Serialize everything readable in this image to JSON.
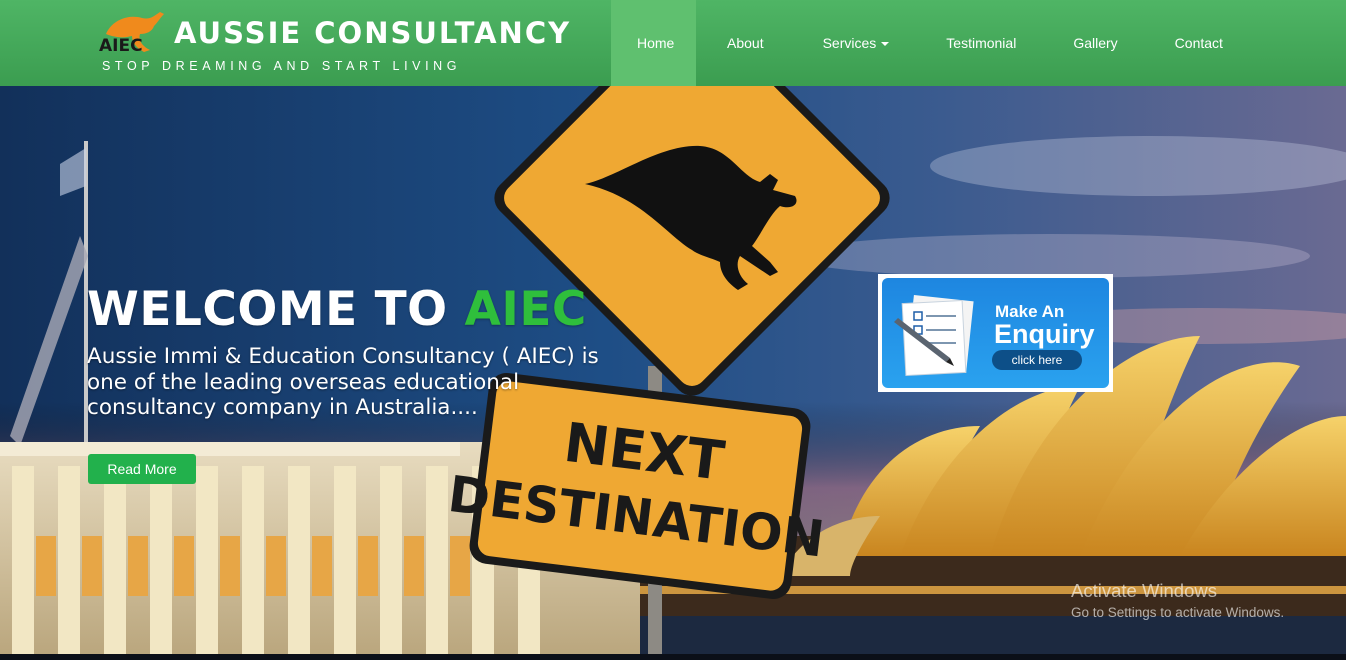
{
  "brand": {
    "logo_text": "AIEC",
    "title": "AUSSIE CONSULTANCY",
    "tagline": "STOP DREAMING AND START LIVING"
  },
  "nav": {
    "items": [
      {
        "label": "Home",
        "active": true
      },
      {
        "label": "About"
      },
      {
        "label": "Services",
        "has_dropdown": true
      },
      {
        "label": "Testimonial"
      },
      {
        "label": "Gallery"
      },
      {
        "label": "Contact"
      }
    ]
  },
  "hero": {
    "welcome_prefix": "WELCOME TO ",
    "welcome_accent": "AIEC",
    "description": "Aussie Immi & Education Consultancy ( AIEC) is one of the leading overseas educational consultancy company in Australia....",
    "read_more_label": "Read More",
    "sign_text_line1": "NEXT",
    "sign_text_line2": "DESTINATION"
  },
  "enquiry": {
    "line1": "Make An",
    "line2": "Enquiry",
    "button_label": "click here"
  },
  "watermark": {
    "title": "Activate Windows",
    "subtitle": "Go to Settings to activate Windows."
  },
  "colors": {
    "nav_green": "#4fb565",
    "accent_green": "#2fbf3c",
    "button_green": "#22b14c",
    "enquiry_blue": "#2a9bea"
  }
}
